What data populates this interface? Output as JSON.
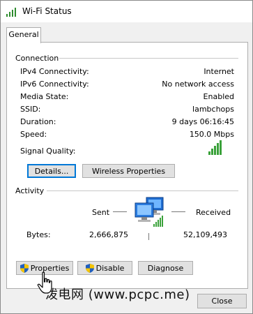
{
  "window": {
    "title": "Wi-Fi Status"
  },
  "tabs": [
    {
      "label": "General"
    }
  ],
  "connection": {
    "heading": "Connection",
    "rows": [
      {
        "label": "IPv4 Connectivity:",
        "value": "Internet"
      },
      {
        "label": "IPv6 Connectivity:",
        "value": "No network access"
      },
      {
        "label": "Media State:",
        "value": "Enabled"
      },
      {
        "label": "SSID:",
        "value": "lambchops"
      },
      {
        "label": "Duration:",
        "value": "9 days 06:16:45"
      },
      {
        "label": "Speed:",
        "value": "150.0 Mbps"
      }
    ],
    "signal_label": "Signal Quality:",
    "signal_bars_lit": 5,
    "signal_bars_total": 5
  },
  "buttons": {
    "details": "Details...",
    "wireless_properties": "Wireless Properties",
    "properties": "Properties",
    "disable": "Disable",
    "diagnose": "Diagnose",
    "close": "Close"
  },
  "activity": {
    "heading": "Activity",
    "sent_label": "Sent",
    "received_label": "Received",
    "bytes_label": "Bytes:",
    "bytes_sent": "2,666,875",
    "bytes_received": "52,109,493"
  },
  "watermark": "泼电网 (www.pcpc.me)",
  "colors": {
    "signal": "#3aa13a",
    "focus": "#0078d7"
  }
}
